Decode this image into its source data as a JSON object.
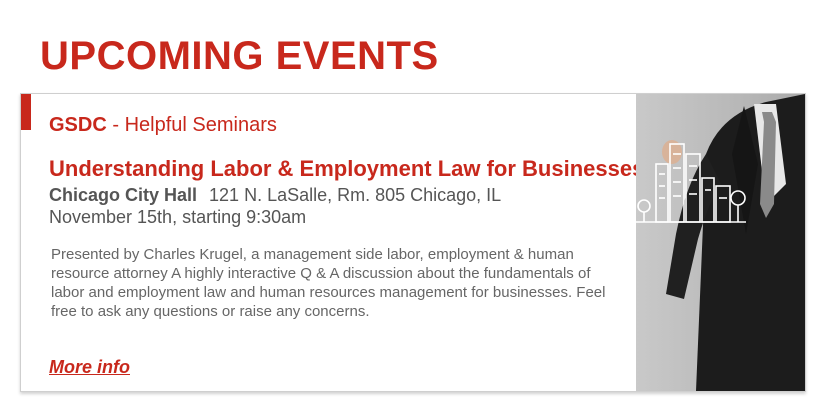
{
  "page": {
    "title": "UPCOMING EVENTS"
  },
  "event": {
    "series_org": "GSDC",
    "series_name": "- Helpful Seminars",
    "title": "Understanding Labor & Employment Law for Businesses",
    "venue": "Chicago City Hall",
    "address": "121 N. LaSalle, Rm. 805 Chicago, IL",
    "datetime": "November 15th, starting 9:30am",
    "description": "Presented by Charles Krugel, a management side labor, employment & human resource attorney A highly interactive Q & A discussion about the fundamentals of labor and employment law and human resources management for businesses. Feel free to ask any questions or raise any concerns.",
    "more_info_label": "More info"
  },
  "colors": {
    "accent": "#c8281c",
    "text_gray": "#555555",
    "body_gray": "#666666"
  },
  "icons": {
    "photo": "businessman-drawing-city-image"
  }
}
